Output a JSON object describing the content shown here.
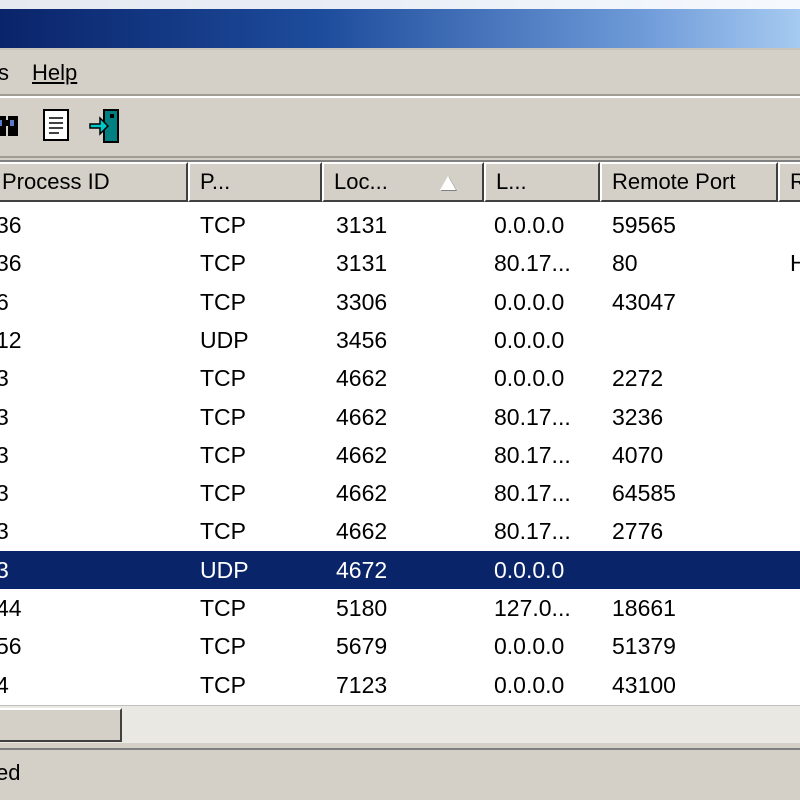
{
  "menu": {
    "partial_item": "s",
    "help": "Help"
  },
  "columns": [
    "Process ID",
    "P...",
    "Loc...",
    "L...",
    "Remote Port",
    "R"
  ],
  "rows": [
    {
      "pid": "36",
      "proto": "TCP",
      "local": "3131",
      "laddr": "0.0.0.0",
      "rport": "59565",
      "extra": ""
    },
    {
      "pid": "36",
      "proto": "TCP",
      "local": "3131",
      "laddr": "80.17...",
      "rport": "80",
      "extra": "H"
    },
    {
      "pid": "6",
      "proto": "TCP",
      "local": "3306",
      "laddr": "0.0.0.0",
      "rport": "43047",
      "extra": ""
    },
    {
      "pid": "12",
      "proto": "UDP",
      "local": "3456",
      "laddr": "0.0.0.0",
      "rport": "",
      "extra": ""
    },
    {
      "pid": "3",
      "proto": "TCP",
      "local": "4662",
      "laddr": "0.0.0.0",
      "rport": "2272",
      "extra": ""
    },
    {
      "pid": "3",
      "proto": "TCP",
      "local": "4662",
      "laddr": "80.17...",
      "rport": "3236",
      "extra": ""
    },
    {
      "pid": "3",
      "proto": "TCP",
      "local": "4662",
      "laddr": "80.17...",
      "rport": "4070",
      "extra": ""
    },
    {
      "pid": "3",
      "proto": "TCP",
      "local": "4662",
      "laddr": "80.17...",
      "rport": "64585",
      "extra": ""
    },
    {
      "pid": "3",
      "proto": "TCP",
      "local": "4662",
      "laddr": "80.17...",
      "rport": "2776",
      "extra": ""
    },
    {
      "pid": "3",
      "proto": "UDP",
      "local": "4672",
      "laddr": "0.0.0.0",
      "rport": "",
      "extra": "",
      "selected": true
    },
    {
      "pid": "44",
      "proto": "TCP",
      "local": "5180",
      "laddr": "127.0...",
      "rport": "18661",
      "extra": ""
    },
    {
      "pid": "56",
      "proto": "TCP",
      "local": "5679",
      "laddr": "0.0.0.0",
      "rport": "51379",
      "extra": ""
    },
    {
      "pid": "4",
      "proto": "TCP",
      "local": "7123",
      "laddr": "0.0.0.0",
      "rport": "43100",
      "extra": ""
    }
  ],
  "status": {
    "text": "ed"
  },
  "icons": [
    "find-icon",
    "properties-icon",
    "exit-icon"
  ],
  "colors": {
    "selection": "#0a246a",
    "title_start": "#0a246a",
    "title_end": "#a6caf0"
  }
}
